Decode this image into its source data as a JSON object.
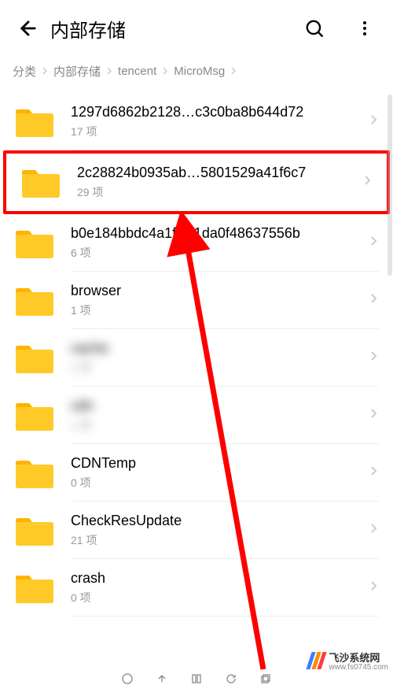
{
  "header": {
    "title": "内部存储"
  },
  "breadcrumbs": [
    "分类",
    "内部存储",
    "tencent",
    "MicroMsg"
  ],
  "item_suffix": " 项",
  "folders": [
    {
      "name": "1297d6862b2128…c3c0ba8b644d72",
      "count": 17,
      "highlight": false,
      "blurred": false
    },
    {
      "name": "2c28824b0935ab…5801529a41f6c7",
      "count": 29,
      "highlight": true,
      "blurred": false
    },
    {
      "name": "b0e184bbdc4a1ff…1da0f48637556b",
      "count": 6,
      "highlight": false,
      "blurred": false
    },
    {
      "name": "browser",
      "count": 1,
      "highlight": false,
      "blurred": false
    },
    {
      "name": "cache",
      "count": 1,
      "highlight": false,
      "blurred": true
    },
    {
      "name": "cdn",
      "count": 1,
      "highlight": false,
      "blurred": true
    },
    {
      "name": "CDNTemp",
      "count": 0,
      "highlight": false,
      "blurred": false
    },
    {
      "name": "CheckResUpdate",
      "count": 21,
      "highlight": false,
      "blurred": false
    },
    {
      "name": "crash",
      "count": 0,
      "highlight": false,
      "blurred": false
    }
  ],
  "colors": {
    "highlight": "#ff0000",
    "folder_fill": "#ffca28",
    "folder_tab": "#ffb300",
    "wm_bars": [
      "#3d7eff",
      "#ff8a00",
      "#ff3b3b"
    ]
  },
  "watermark": {
    "main": "飞沙系统网",
    "sub": "www.fs0745.com"
  }
}
